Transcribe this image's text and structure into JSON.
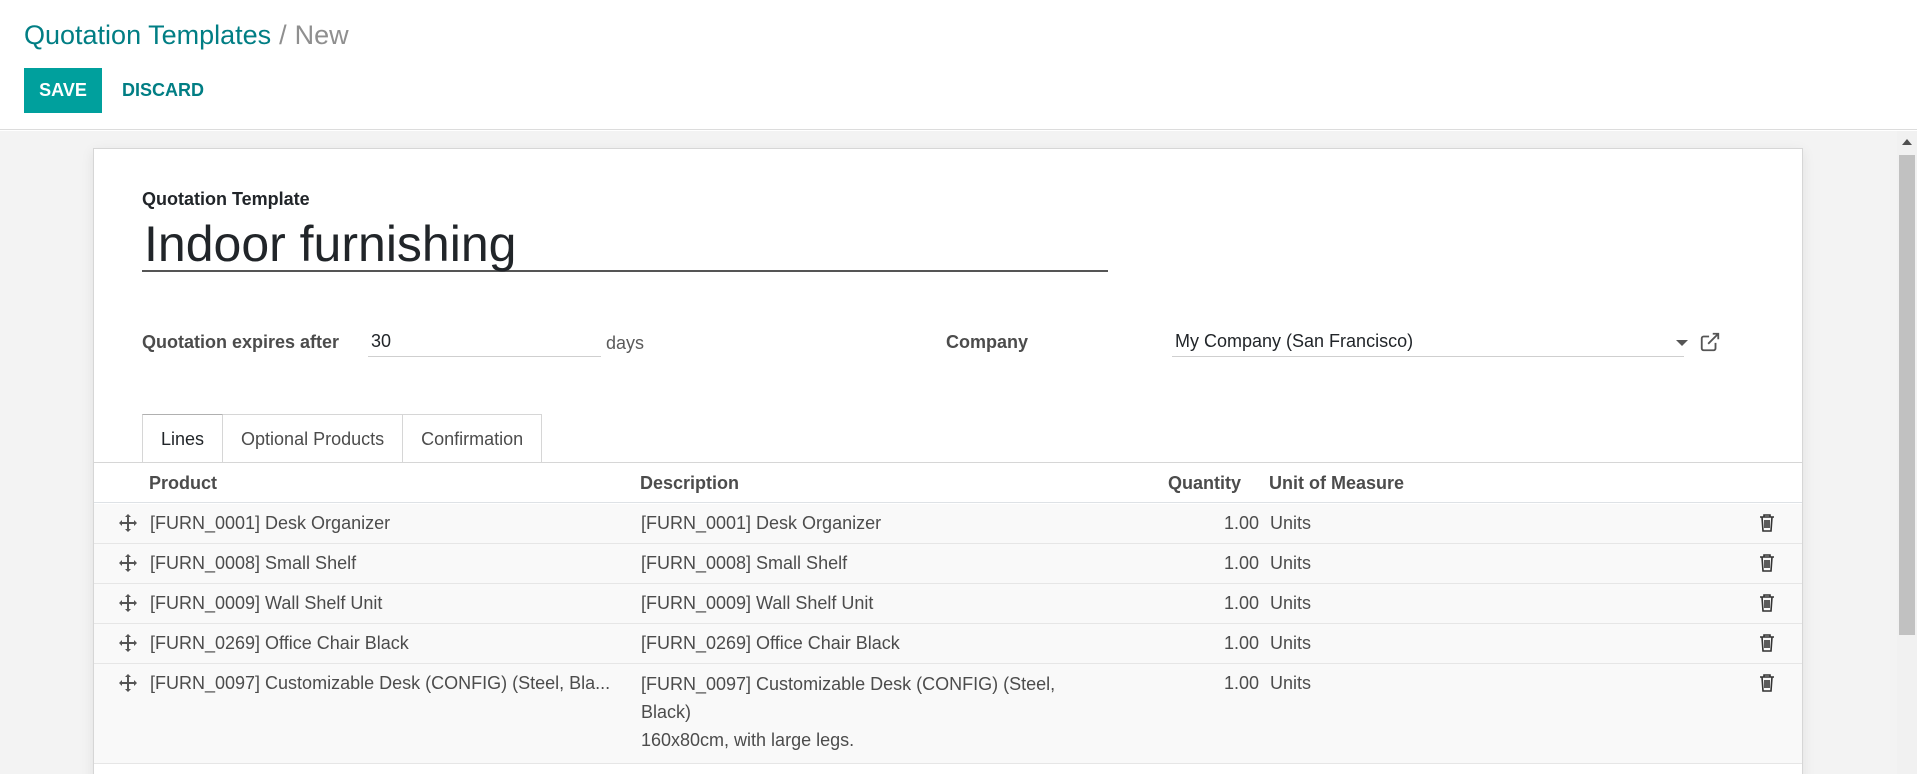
{
  "breadcrumb": {
    "parent": "Quotation Templates",
    "separator": "/",
    "current": "New"
  },
  "toolbar": {
    "save_label": "SAVE",
    "discard_label": "DISCARD"
  },
  "form": {
    "title_label": "Quotation Template",
    "name": "Indoor furnishing",
    "expires_label": "Quotation expires after",
    "expires_value": "30",
    "expires_suffix": "days",
    "company_label": "Company",
    "company_value": "My Company (San Francisco)"
  },
  "tabs": [
    {
      "label": "Lines",
      "active": true
    },
    {
      "label": "Optional Products",
      "active": false
    },
    {
      "label": "Confirmation",
      "active": false
    }
  ],
  "table": {
    "headers": {
      "product": "Product",
      "description": "Description",
      "quantity": "Quantity",
      "uom": "Unit of Measure"
    },
    "rows": [
      {
        "product": "[FURN_0001] Desk Organizer",
        "description": "[FURN_0001] Desk Organizer",
        "quantity": "1.00",
        "uom": "Units"
      },
      {
        "product": "[FURN_0008] Small Shelf",
        "description": "[FURN_0008] Small Shelf",
        "quantity": "1.00",
        "uom": "Units"
      },
      {
        "product": "[FURN_0009] Wall Shelf Unit",
        "description": "[FURN_0009] Wall Shelf Unit",
        "quantity": "1.00",
        "uom": "Units"
      },
      {
        "product": "[FURN_0269] Office Chair Black",
        "description": "[FURN_0269] Office Chair Black",
        "quantity": "1.00",
        "uom": "Units"
      },
      {
        "product": "[FURN_0097] Customizable Desk (CONFIG) (Steel, Bla...",
        "description_line1": "[FURN_0097] Customizable Desk (CONFIG) (Steel,",
        "description_line2": "Black)",
        "description_line3": "160x80cm, with large legs.",
        "quantity": "1.00",
        "uom": "Units"
      }
    ]
  },
  "colors": {
    "primary": "#00a09d",
    "link": "#017e84",
    "text": "#4c4c4c"
  }
}
